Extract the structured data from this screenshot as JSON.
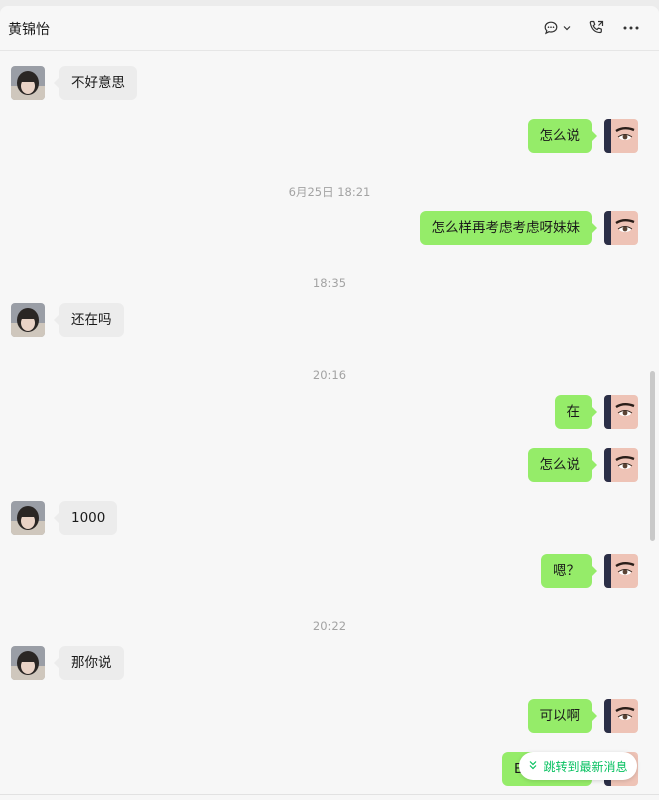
{
  "header": {
    "title": "黄锦怡",
    "icons": [
      "chat-bubble-icon",
      "chevron-down-icon",
      "voice-call-icon",
      "more-icon"
    ]
  },
  "messages": [
    {
      "side": "left",
      "text": "不好意思"
    },
    {
      "side": "right",
      "text": "怎么说"
    },
    {
      "time": "6月25日 18:21"
    },
    {
      "side": "right",
      "text": "怎么样再考虑考虑呀妹妹"
    },
    {
      "time": "18:35"
    },
    {
      "side": "left",
      "text": "还在吗"
    },
    {
      "time": "20:16"
    },
    {
      "side": "right",
      "text": "在"
    },
    {
      "side": "right",
      "text": "怎么说"
    },
    {
      "side": "left",
      "text": "1000"
    },
    {
      "side": "right",
      "text": "嗯？"
    },
    {
      "time": "20:22"
    },
    {
      "side": "left",
      "text": "那你说"
    },
    {
      "side": "right",
      "text": "可以啊"
    },
    {
      "side": "right",
      "text": "B"
    }
  ],
  "jump_button": {
    "label": "跳转到最新消息",
    "icon": "double-chevron-down-icon"
  },
  "colors": {
    "sent_bubble": "#95ec69",
    "received_bubble": "#ececec",
    "accent": "#07c160"
  }
}
